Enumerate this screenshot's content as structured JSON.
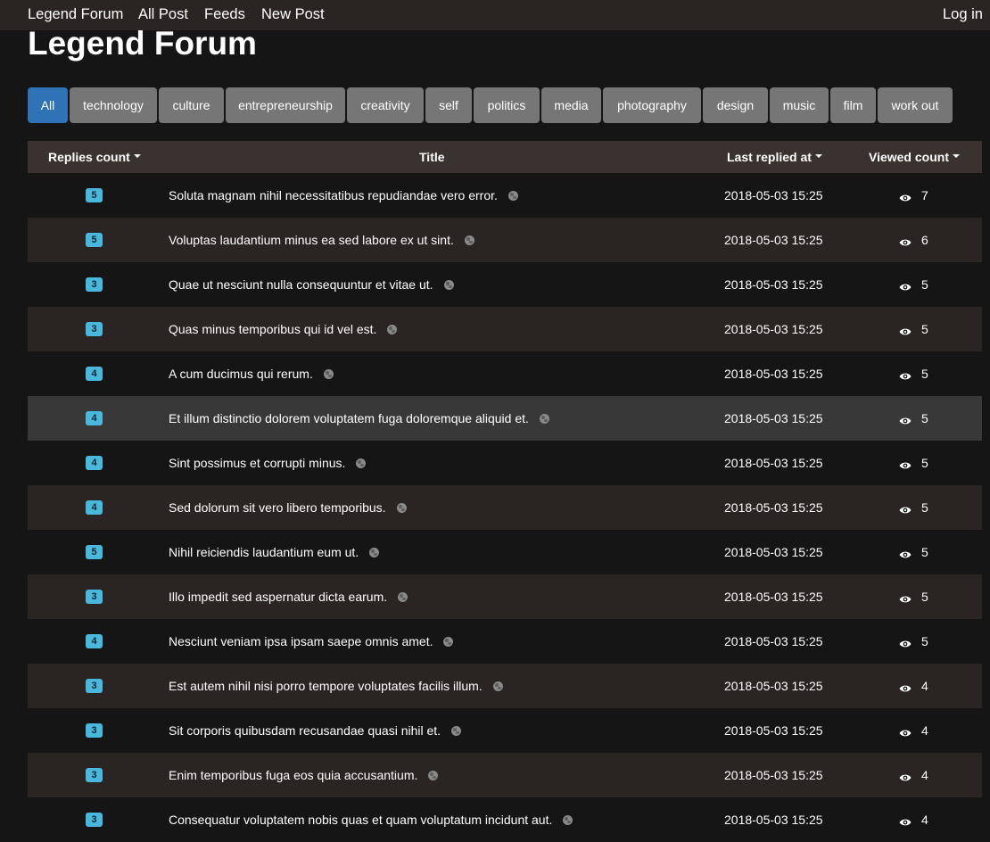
{
  "nav": {
    "brand": "Legend Forum",
    "links": [
      "All Post",
      "Feeds",
      "New Post"
    ],
    "login": "Log in"
  },
  "page_title": "Legend Forum",
  "tags": [
    "All",
    "technology",
    "culture",
    "entrepreneurship",
    "creativity",
    "self",
    "politics",
    "media",
    "photography",
    "design",
    "music",
    "film",
    "work out"
  ],
  "active_tag": "All",
  "table": {
    "headers": {
      "replies": "Replies count",
      "title": "Title",
      "last_replied": "Last replied at",
      "viewed": "Viewed count"
    },
    "rows": [
      {
        "replies": "5",
        "title": "Soluta magnam nihil necessitatibus repudiandae vero error.",
        "last_replied": "2018-05-03 15:25",
        "views": "7"
      },
      {
        "replies": "5",
        "title": "Voluptas laudantium minus ea sed labore ex ut sint.",
        "last_replied": "2018-05-03 15:25",
        "views": "6"
      },
      {
        "replies": "3",
        "title": "Quae ut nesciunt nulla consequuntur et vitae ut.",
        "last_replied": "2018-05-03 15:25",
        "views": "5"
      },
      {
        "replies": "3",
        "title": "Quas minus temporibus qui id vel est.",
        "last_replied": "2018-05-03 15:25",
        "views": "5"
      },
      {
        "replies": "4",
        "title": "A cum ducimus qui rerum.",
        "last_replied": "2018-05-03 15:25",
        "views": "5"
      },
      {
        "replies": "4",
        "title": "Et illum distinctio dolorem voluptatem fuga doloremque aliquid et.",
        "last_replied": "2018-05-03 15:25",
        "views": "5"
      },
      {
        "replies": "4",
        "title": "Sint possimus et corrupti minus.",
        "last_replied": "2018-05-03 15:25",
        "views": "5"
      },
      {
        "replies": "4",
        "title": "Sed dolorum sit vero libero temporibus.",
        "last_replied": "2018-05-03 15:25",
        "views": "5"
      },
      {
        "replies": "5",
        "title": "Nihil reiciendis laudantium eum ut.",
        "last_replied": "2018-05-03 15:25",
        "views": "5"
      },
      {
        "replies": "3",
        "title": "Illo impedit sed aspernatur dicta earum.",
        "last_replied": "2018-05-03 15:25",
        "views": "5"
      },
      {
        "replies": "4",
        "title": "Nesciunt veniam ipsa ipsam saepe omnis amet.",
        "last_replied": "2018-05-03 15:25",
        "views": "5"
      },
      {
        "replies": "3",
        "title": "Est autem nihil nisi porro tempore voluptates facilis illum.",
        "last_replied": "2018-05-03 15:25",
        "views": "4"
      },
      {
        "replies": "3",
        "title": "Sit corporis quibusdam recusandae quasi nihil et.",
        "last_replied": "2018-05-03 15:25",
        "views": "4"
      },
      {
        "replies": "3",
        "title": "Enim temporibus fuga eos quia accusantium.",
        "last_replied": "2018-05-03 15:25",
        "views": "4"
      },
      {
        "replies": "3",
        "title": "Consequatur voluptatem nobis quas et quam voluptatum incidunt aut.",
        "last_replied": "2018-05-03 15:25",
        "views": "4"
      }
    ]
  },
  "icons": {
    "globe": "globe-icon",
    "eye": "eye-icon",
    "caret": "caret-down-icon"
  },
  "colors": {
    "navbar": "#2a2523",
    "active_tag": "#2f73b6",
    "tag": "#767676",
    "badge": "#4ab8dd",
    "table_header": "#3a322f",
    "row_alt": "#2a2523",
    "row_hover": "#383838"
  }
}
